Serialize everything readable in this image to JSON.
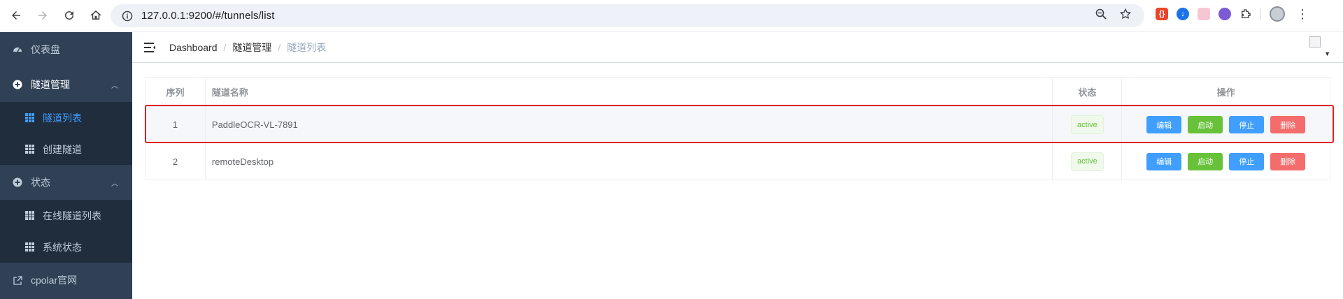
{
  "browser": {
    "url": "127.0.0.1:9200/#/tunnels/list"
  },
  "sidebar": {
    "items": [
      {
        "label": "仪表盘"
      },
      {
        "label": "隧道管理"
      },
      {
        "label": "隧道列表"
      },
      {
        "label": "创建隧道"
      },
      {
        "label": "状态"
      },
      {
        "label": "在线隧道列表"
      },
      {
        "label": "系统状态"
      },
      {
        "label": "cpolar官网"
      }
    ]
  },
  "breadcrumb": {
    "items": [
      "Dashboard",
      "隧道管理",
      "隧道列表"
    ],
    "separator": "/"
  },
  "table": {
    "headers": [
      "序列",
      "隧道名称",
      "状态",
      "操作"
    ],
    "rows": [
      {
        "index": "1",
        "name": "PaddleOCR-VL-7891",
        "status": "active"
      },
      {
        "index": "2",
        "name": "remoteDesktop",
        "status": "active"
      }
    ],
    "actions": [
      "编辑",
      "启动",
      "停止",
      "删除"
    ]
  },
  "colors": {
    "sidebar_bg": "#304156",
    "submenu_bg": "#1f2d3d",
    "active_menu": "#409eff",
    "primary": "#409eff",
    "success": "#67c23a",
    "danger": "#f56c6c",
    "highlight": "#e02020"
  }
}
